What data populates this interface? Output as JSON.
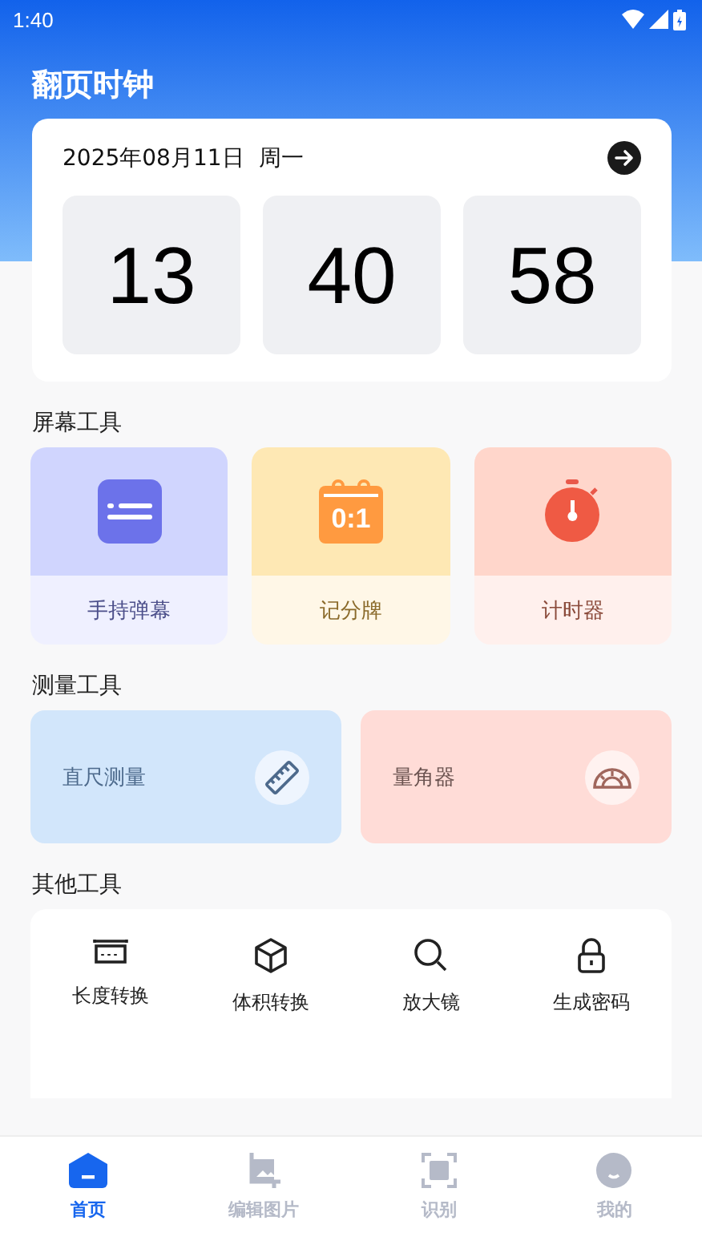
{
  "status_bar": {
    "time": "1:40"
  },
  "header": {
    "title": "翻页时钟"
  },
  "clock": {
    "date": "2025年08月11日",
    "weekday": "周一",
    "hours": "13",
    "minutes": "40",
    "seconds": "58"
  },
  "sections": [
    {
      "title": "屏幕工具",
      "kind": "tiles",
      "items": [
        {
          "label": "手持弹幕",
          "kind": "danmaku"
        },
        {
          "label": "记分牌",
          "kind": "scoreboard",
          "icon_text": "0:1"
        },
        {
          "label": "计时器",
          "kind": "timer"
        }
      ]
    },
    {
      "title": "测量工具",
      "kind": "cards",
      "items": [
        {
          "label": "直尺测量",
          "kind": "ruler"
        },
        {
          "label": "量角器",
          "kind": "protractor"
        }
      ]
    },
    {
      "title": "其他工具",
      "kind": "grid",
      "items": [
        {
          "label": "长度转换",
          "kind": "length"
        },
        {
          "label": "体积转换",
          "kind": "cube"
        },
        {
          "label": "放大镜",
          "kind": "magnifier"
        },
        {
          "label": "生成密码",
          "kind": "lock"
        }
      ]
    }
  ],
  "nav": [
    {
      "label": "首页",
      "kind": "home",
      "selected": true
    },
    {
      "label": "编辑图片",
      "kind": "image",
      "selected": false
    },
    {
      "label": "识别",
      "kind": "scan",
      "selected": false
    },
    {
      "label": "我的",
      "kind": "face",
      "selected": false
    }
  ]
}
